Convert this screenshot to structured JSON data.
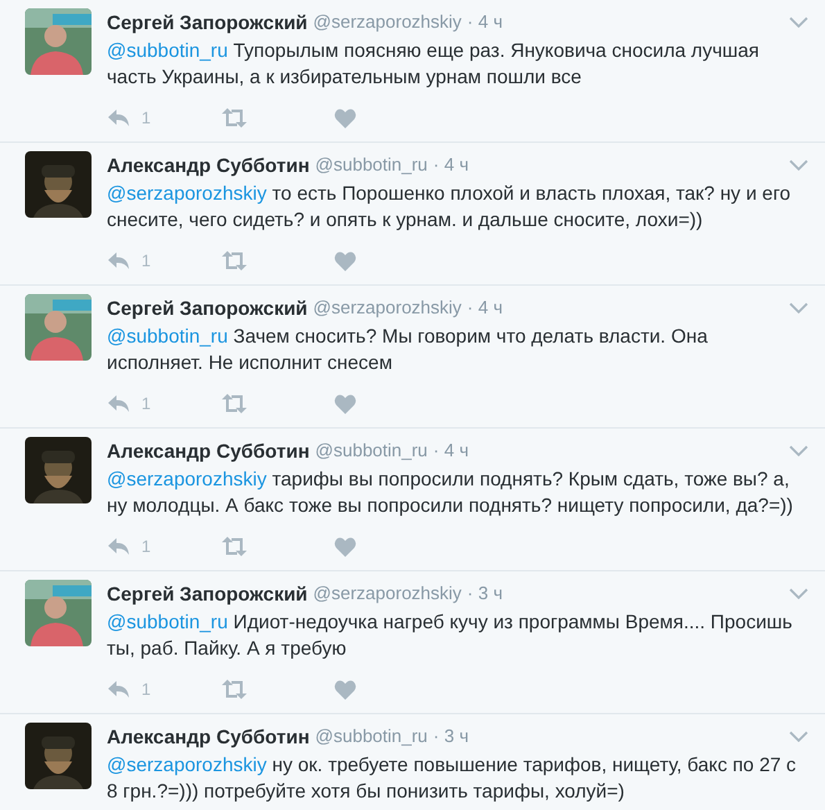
{
  "tweets": [
    {
      "name": "Сергей Запорожский",
      "handle": "@serzaporozhskiy",
      "time": "· 4 ч",
      "mention": "@subbotin_ru",
      "text": " Тупорылым поясняю еще раз. Януковича сносила лучшая часть Украины, а к избирательным урнам пошли все",
      "reply_count": "1"
    },
    {
      "name": "Александр Субботин",
      "handle": "@subbotin_ru",
      "time": "· 4 ч",
      "mention": "@serzaporozhskiy",
      "text": " то есть Порошенко плохой и власть плохая, так? ну и его снесите, чего сидеть? и опять к урнам. и дальше сносите, лохи=))",
      "reply_count": "1"
    },
    {
      "name": "Сергей Запорожский",
      "handle": "@serzaporozhskiy",
      "time": "· 4 ч",
      "mention": "@subbotin_ru",
      "text": " Зачем сносить? Мы говорим что делать власти. Она исполняет. Не исполнит снесем",
      "reply_count": "1"
    },
    {
      "name": "Александр Субботин",
      "handle": "@subbotin_ru",
      "time": "· 4 ч",
      "mention": "@serzaporozhskiy",
      "text": " тарифы вы попросили поднять? Крым сдать, тоже вы? а, ну молодцы. А бакс тоже вы попросили поднять? нищету попросили, да?=))",
      "reply_count": "1"
    },
    {
      "name": "Сергей Запорожский",
      "handle": "@serzaporozhskiy",
      "time": "· 3 ч",
      "mention": "@subbotin_ru",
      "text": " Идиот-недоучка нагреб кучу из программы Время.... Просишь ты, раб. Пайку. А я требую",
      "reply_count": "1"
    },
    {
      "name": "Александр Субботин",
      "handle": "@subbotin_ru",
      "time": "· 3 ч",
      "mention": "@serzaporozhskiy",
      "text": " ну ок. требуете повышение тарифов, нищету, бакс по 27 с 8 грн.?=))) потребуйте хотя бы понизить тарифы, холуй=)"
    }
  ]
}
